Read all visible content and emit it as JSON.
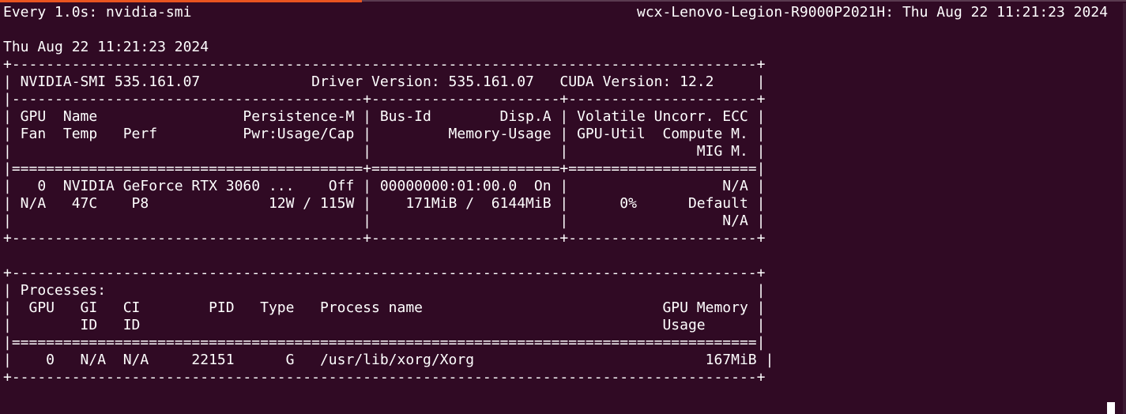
{
  "watch": {
    "command_label": "Every 1.0s: nvidia-smi",
    "host_time": "wcx-Lenovo-Legion-R9000P2021H: Thu Aug 22 11:21:23 2024"
  },
  "output": {
    "timestamp": "Thu Aug 22 11:21:23 2024",
    "lines": [
      "+---------------------------------------------------------------------------------------+",
      "| NVIDIA-SMI 535.161.07             Driver Version: 535.161.07   CUDA Version: 12.2     |",
      "|-----------------------------------------+----------------------+----------------------+",
      "| GPU  Name                 Persistence-M | Bus-Id        Disp.A | Volatile Uncorr. ECC |",
      "| Fan  Temp   Perf          Pwr:Usage/Cap |         Memory-Usage | GPU-Util  Compute M. |",
      "|                                         |                      |               MIG M. |",
      "|=========================================+======================+======================|",
      "|   0  NVIDIA GeForce RTX 3060 ...    Off | 00000000:01:00.0  On |                  N/A |",
      "| N/A   47C    P8              12W / 115W |    171MiB /  6144MiB |      0%      Default |",
      "|                                         |                      |                  N/A |",
      "+-----------------------------------------+----------------------+----------------------+",
      "",
      "+---------------------------------------------------------------------------------------+",
      "| Processes:                                                                            |",
      "|  GPU   GI   CI        PID   Type   Process name                            GPU Memory |",
      "|        ID   ID                                                             Usage      |",
      "|=======================================================================================|",
      "|    0   N/A  N/A     22151      G   /usr/lib/xorg/Xorg                           167MiB |",
      "+---------------------------------------------------------------------------------------+"
    ]
  },
  "colors": {
    "background": "#300a24",
    "foreground": "#ffffff",
    "accent": "#e95420"
  }
}
